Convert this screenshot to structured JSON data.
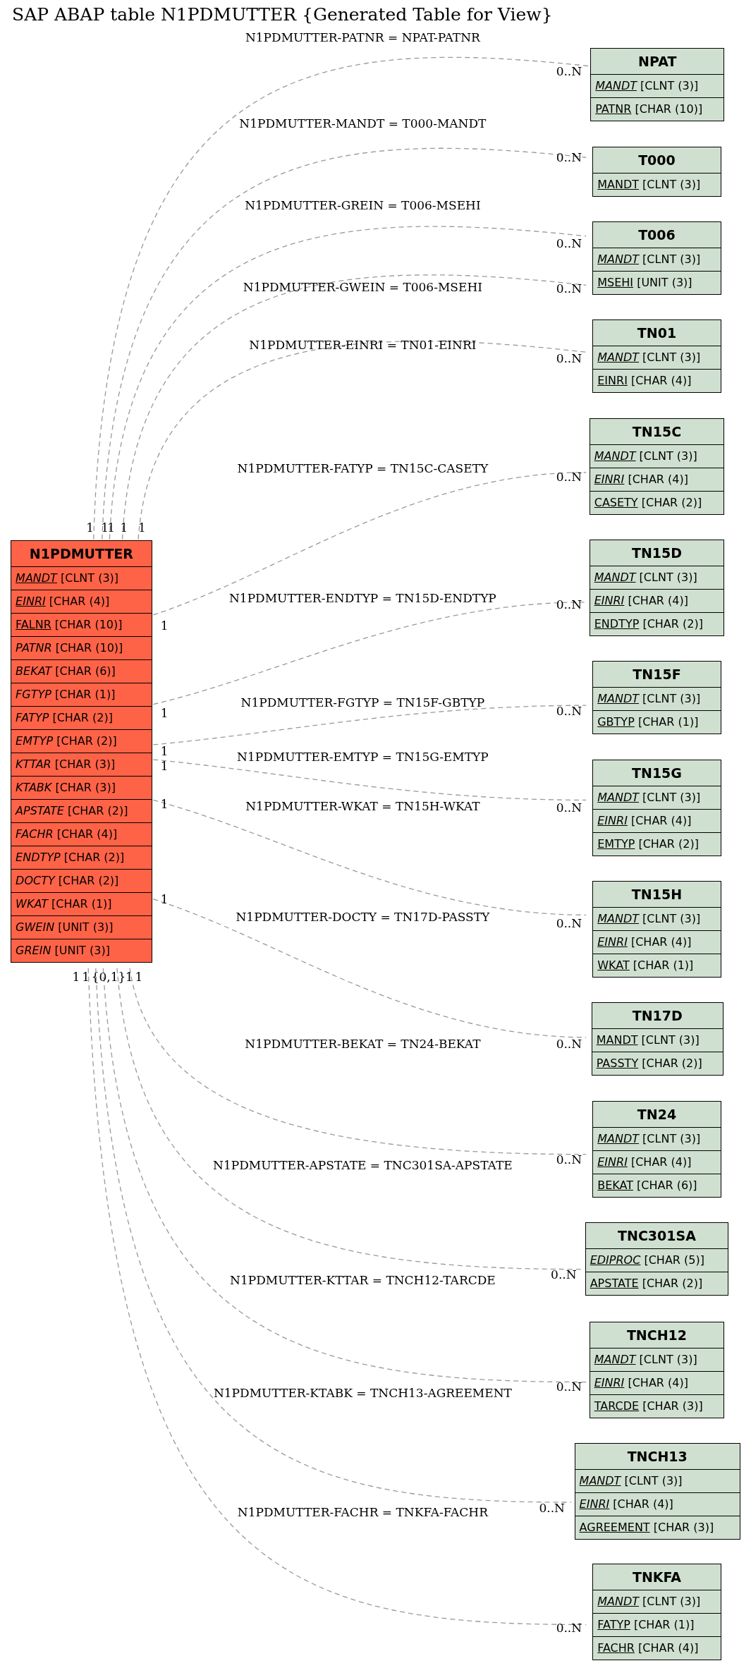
{
  "title": "SAP ABAP table N1PDMUTTER {Generated Table for View}",
  "main_table": {
    "name": "N1PDMUTTER",
    "fields": [
      {
        "name": "MANDT",
        "type": "[CLNT (3)]",
        "primary_key": true,
        "foreign_key": true
      },
      {
        "name": "EINRI",
        "type": "[CHAR (4)]",
        "primary_key": true,
        "foreign_key": true
      },
      {
        "name": "FALNR",
        "type": "[CHAR (10)]",
        "primary_key": true,
        "foreign_key": false
      },
      {
        "name": "PATNR",
        "type": "[CHAR (10)]",
        "primary_key": false,
        "foreign_key": true
      },
      {
        "name": "BEKAT",
        "type": "[CHAR (6)]",
        "primary_key": false,
        "foreign_key": true
      },
      {
        "name": "FGTYP",
        "type": "[CHAR (1)]",
        "primary_key": false,
        "foreign_key": true
      },
      {
        "name": "FATYP",
        "type": "[CHAR (2)]",
        "primary_key": false,
        "foreign_key": true
      },
      {
        "name": "EMTYP",
        "type": "[CHAR (2)]",
        "primary_key": false,
        "foreign_key": true
      },
      {
        "name": "KTTAR",
        "type": "[CHAR (3)]",
        "primary_key": false,
        "foreign_key": true
      },
      {
        "name": "KTABK",
        "type": "[CHAR (3)]",
        "primary_key": false,
        "foreign_key": true
      },
      {
        "name": "APSTATE",
        "type": "[CHAR (2)]",
        "primary_key": false,
        "foreign_key": true
      },
      {
        "name": "FACHR",
        "type": "[CHAR (4)]",
        "primary_key": false,
        "foreign_key": true
      },
      {
        "name": "ENDTYP",
        "type": "[CHAR (2)]",
        "primary_key": false,
        "foreign_key": true
      },
      {
        "name": "DOCTY",
        "type": "[CHAR (2)]",
        "primary_key": false,
        "foreign_key": true
      },
      {
        "name": "WKAT",
        "type": "[CHAR (1)]",
        "primary_key": false,
        "foreign_key": true
      },
      {
        "name": "GWEIN",
        "type": "[UNIT (3)]",
        "primary_key": false,
        "foreign_key": true
      },
      {
        "name": "GREIN",
        "type": "[UNIT (3)]",
        "primary_key": false,
        "foreign_key": true
      }
    ]
  },
  "related_tables": [
    {
      "name": "NPAT",
      "fields": [
        {
          "name": "MANDT",
          "type": "[CLNT (3)]",
          "primary_key": true,
          "foreign_key": true
        },
        {
          "name": "PATNR",
          "type": "[CHAR (10)]",
          "primary_key": true,
          "foreign_key": false
        }
      ]
    },
    {
      "name": "T000",
      "fields": [
        {
          "name": "MANDT",
          "type": "[CLNT (3)]",
          "primary_key": true,
          "foreign_key": false
        }
      ]
    },
    {
      "name": "T006",
      "fields": [
        {
          "name": "MANDT",
          "type": "[CLNT (3)]",
          "primary_key": true,
          "foreign_key": true
        },
        {
          "name": "MSEHI",
          "type": "[UNIT (3)]",
          "primary_key": true,
          "foreign_key": false
        }
      ]
    },
    {
      "name": "TN01",
      "fields": [
        {
          "name": "MANDT",
          "type": "[CLNT (3)]",
          "primary_key": true,
          "foreign_key": true
        },
        {
          "name": "EINRI",
          "type": "[CHAR (4)]",
          "primary_key": true,
          "foreign_key": false
        }
      ]
    },
    {
      "name": "TN15C",
      "fields": [
        {
          "name": "MANDT",
          "type": "[CLNT (3)]",
          "primary_key": true,
          "foreign_key": true
        },
        {
          "name": "EINRI",
          "type": "[CHAR (4)]",
          "primary_key": true,
          "foreign_key": true
        },
        {
          "name": "CASETY",
          "type": "[CHAR (2)]",
          "primary_key": true,
          "foreign_key": false
        }
      ]
    },
    {
      "name": "TN15D",
      "fields": [
        {
          "name": "MANDT",
          "type": "[CLNT (3)]",
          "primary_key": true,
          "foreign_key": true
        },
        {
          "name": "EINRI",
          "type": "[CHAR (4)]",
          "primary_key": true,
          "foreign_key": true
        },
        {
          "name": "ENDTYP",
          "type": "[CHAR (2)]",
          "primary_key": true,
          "foreign_key": false
        }
      ]
    },
    {
      "name": "TN15F",
      "fields": [
        {
          "name": "MANDT",
          "type": "[CLNT (3)]",
          "primary_key": true,
          "foreign_key": true
        },
        {
          "name": "GBTYP",
          "type": "[CHAR (1)]",
          "primary_key": true,
          "foreign_key": false
        }
      ]
    },
    {
      "name": "TN15G",
      "fields": [
        {
          "name": "MANDT",
          "type": "[CLNT (3)]",
          "primary_key": true,
          "foreign_key": true
        },
        {
          "name": "EINRI",
          "type": "[CHAR (4)]",
          "primary_key": true,
          "foreign_key": true
        },
        {
          "name": "EMTYP",
          "type": "[CHAR (2)]",
          "primary_key": true,
          "foreign_key": false
        }
      ]
    },
    {
      "name": "TN15H",
      "fields": [
        {
          "name": "MANDT",
          "type": "[CLNT (3)]",
          "primary_key": true,
          "foreign_key": true
        },
        {
          "name": "EINRI",
          "type": "[CHAR (4)]",
          "primary_key": true,
          "foreign_key": true
        },
        {
          "name": "WKAT",
          "type": "[CHAR (1)]",
          "primary_key": true,
          "foreign_key": false
        }
      ]
    },
    {
      "name": "TN17D",
      "fields": [
        {
          "name": "MANDT",
          "type": "[CLNT (3)]",
          "primary_key": true,
          "foreign_key": false
        },
        {
          "name": "PASSTY",
          "type": "[CHAR (2)]",
          "primary_key": true,
          "foreign_key": false
        }
      ]
    },
    {
      "name": "TN24",
      "fields": [
        {
          "name": "MANDT",
          "type": "[CLNT (3)]",
          "primary_key": true,
          "foreign_key": true
        },
        {
          "name": "EINRI",
          "type": "[CHAR (4)]",
          "primary_key": true,
          "foreign_key": true
        },
        {
          "name": "BEKAT",
          "type": "[CHAR (6)]",
          "primary_key": true,
          "foreign_key": false
        }
      ]
    },
    {
      "name": "TNC301SA",
      "fields": [
        {
          "name": "EDIPROC",
          "type": "[CHAR (5)]",
          "primary_key": true,
          "foreign_key": true
        },
        {
          "name": "APSTATE",
          "type": "[CHAR (2)]",
          "primary_key": true,
          "foreign_key": false
        }
      ]
    },
    {
      "name": "TNCH12",
      "fields": [
        {
          "name": "MANDT",
          "type": "[CLNT (3)]",
          "primary_key": true,
          "foreign_key": true
        },
        {
          "name": "EINRI",
          "type": "[CHAR (4)]",
          "primary_key": true,
          "foreign_key": true
        },
        {
          "name": "TARCDE",
          "type": "[CHAR (3)]",
          "primary_key": true,
          "foreign_key": false
        }
      ]
    },
    {
      "name": "TNCH13",
      "fields": [
        {
          "name": "MANDT",
          "type": "[CLNT (3)]",
          "primary_key": true,
          "foreign_key": true
        },
        {
          "name": "EINRI",
          "type": "[CHAR (4)]",
          "primary_key": true,
          "foreign_key": true
        },
        {
          "name": "AGREEMENT",
          "type": "[CHAR (3)]",
          "primary_key": true,
          "foreign_key": false
        }
      ]
    },
    {
      "name": "TNKFA",
      "fields": [
        {
          "name": "MANDT",
          "type": "[CLNT (3)]",
          "primary_key": true,
          "foreign_key": true
        },
        {
          "name": "FATYP",
          "type": "[CHAR (1)]",
          "primary_key": true,
          "foreign_key": false
        },
        {
          "name": "FACHR",
          "type": "[CHAR (4)]",
          "primary_key": true,
          "foreign_key": false
        }
      ]
    }
  ],
  "relations": [
    {
      "label": "N1PDMUTTER-PATNR = NPAT-PATNR",
      "from_cardinality": "1",
      "to_cardinality": "0..N"
    },
    {
      "label": "N1PDMUTTER-MANDT = T000-MANDT",
      "from_cardinality": "1",
      "to_cardinality": "0..N"
    },
    {
      "label": "N1PDMUTTER-GREIN = T006-MSEHI",
      "from_cardinality": "1",
      "to_cardinality": "0..N"
    },
    {
      "label": "N1PDMUTTER-GWEIN = T006-MSEHI",
      "from_cardinality": "1",
      "to_cardinality": "0..N"
    },
    {
      "label": "N1PDMUTTER-EINRI = TN01-EINRI",
      "from_cardinality": "1",
      "to_cardinality": "0..N"
    },
    {
      "label": "N1PDMUTTER-FATYP = TN15C-CASETY",
      "from_cardinality": "1",
      "to_cardinality": "0..N"
    },
    {
      "label": "N1PDMUTTER-ENDTYP = TN15D-ENDTYP",
      "from_cardinality": "1",
      "to_cardinality": "0..N"
    },
    {
      "label": "N1PDMUTTER-FGTYP = TN15F-GBTYP",
      "from_cardinality": "1",
      "to_cardinality": "0..N"
    },
    {
      "label": "N1PDMUTTER-EMTYP = TN15G-EMTYP",
      "from_cardinality": "1",
      "to_cardinality": "0..N"
    },
    {
      "label": "N1PDMUTTER-WKAT = TN15H-WKAT",
      "from_cardinality": "1",
      "to_cardinality": "0..N"
    },
    {
      "label": "N1PDMUTTER-DOCTY = TN17D-PASSTY",
      "from_cardinality": "1",
      "to_cardinality": "0..N"
    },
    {
      "label": "N1PDMUTTER-BEKAT = TN24-BEKAT",
      "from_cardinality": "1",
      "to_cardinality": "0..N"
    },
    {
      "label": "N1PDMUTTER-APSTATE = TNC301SA-APSTATE",
      "from_cardinality": "1",
      "to_cardinality": "0..N"
    },
    {
      "label": "N1PDMUTTER-KTTAR = TNCH12-TARCDE",
      "from_cardinality": "{0,1}",
      "to_cardinality": "0..N"
    },
    {
      "label": "N1PDMUTTER-KTABK = TNCH13-AGREEMENT",
      "from_cardinality": "1",
      "to_cardinality": "0..N"
    },
    {
      "label": "N1PDMUTTER-FACHR = TNKFA-FACHR",
      "from_cardinality": "1",
      "to_cardinality": "0..N"
    }
  ]
}
